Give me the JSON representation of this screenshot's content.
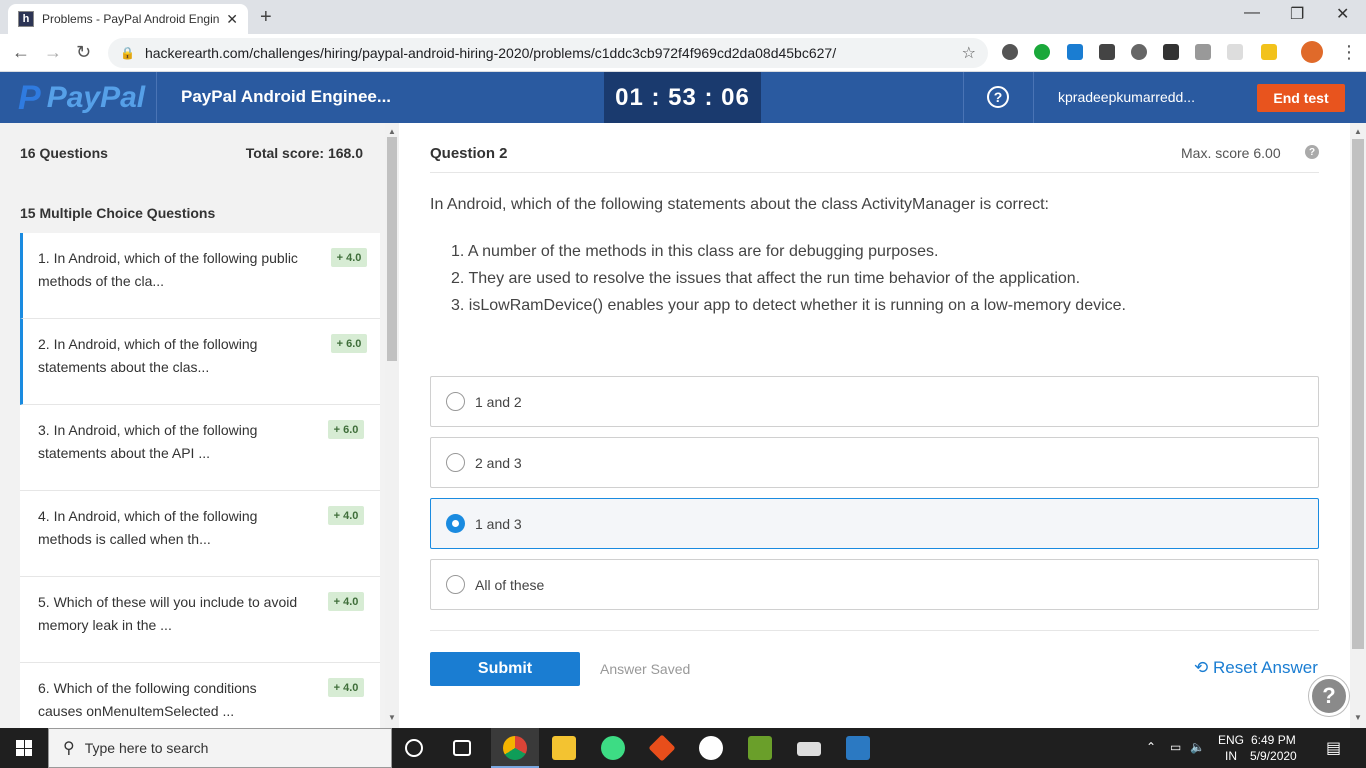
{
  "browser": {
    "tab_title": "Problems - PayPal Android Engin",
    "tab_favicon": "h",
    "url": "hackerearth.com/challenges/hiring/paypal-android-hiring-2020/problems/c1ddc3cb972f4f969cd2da08d45bc627/"
  },
  "header": {
    "logo_text": "PayPal",
    "logo_mark": "P",
    "test_name": "PayPal Android Enginee...",
    "timer": "01 : 53 : 06",
    "help": "?",
    "username": "kpradeepkumarredd...",
    "end_test": "End test"
  },
  "sidebar": {
    "question_count": "16 Questions",
    "total_score": "Total score: 168.0",
    "section_title": "15 Multiple Choice Questions",
    "items": [
      {
        "text": "1. In Android, which of the following public methods of the cla...",
        "score": "+ 4.0"
      },
      {
        "text": "2. In Android, which of the following statements about the clas...",
        "score": "+ 6.0"
      },
      {
        "text": "3. In Android, which of the following statements about the API ...",
        "score": "+ 6.0"
      },
      {
        "text": "4. In Android, which of the following methods is called when th...",
        "score": "+ 4.0"
      },
      {
        "text": "5. Which of these will you include to avoid memory leak in the ...",
        "score": "+ 4.0"
      },
      {
        "text": "6. Which of the following conditions causes onMenuItemSelected ...",
        "score": "+ 4.0"
      }
    ]
  },
  "question": {
    "title": "Question  2",
    "max_score": "Max. score 6.00",
    "body": "In Android, which of the following statements about the class ActivityManager is correct:",
    "statements": [
      "1. A number of the methods in this class are for debugging purposes.",
      "2. They are used to resolve the issues that affect the run time behavior of the application.",
      "3. isLowRamDevice() enables your app to detect whether it is running on a low-memory device."
    ],
    "options": [
      {
        "label": "1 and 2",
        "selected": false
      },
      {
        "label": "2 and 3",
        "selected": false
      },
      {
        "label": "1 and 3",
        "selected": true
      },
      {
        "label": "All of these",
        "selected": false
      }
    ],
    "submit": "Submit",
    "status": "Answer Saved",
    "reset": "Reset Answer"
  },
  "taskbar": {
    "search_placeholder": "Type here to search",
    "lang_top": "ENG",
    "lang_bottom": "IN",
    "time": "6:49 PM",
    "date": "5/9/2020"
  },
  "colors": {
    "header_bg": "#2a5aa0",
    "end_test": "#e8541e",
    "accent": "#1a7dd2"
  }
}
